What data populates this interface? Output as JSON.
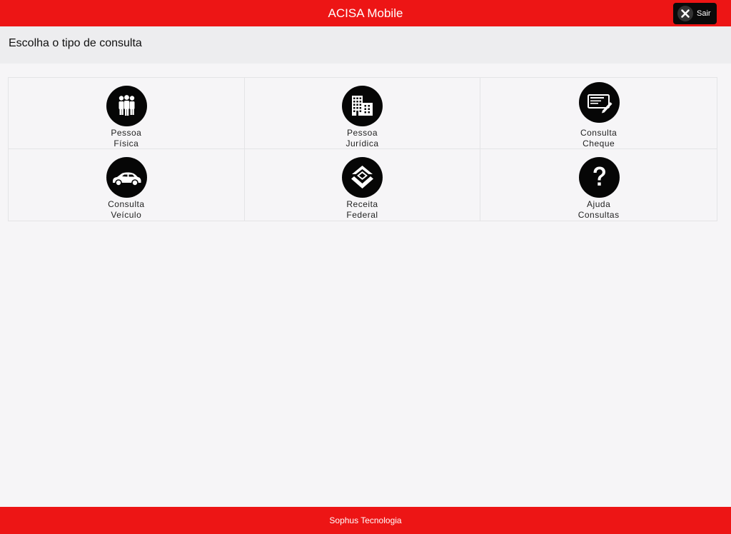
{
  "header": {
    "title": "ACISA Mobile",
    "exit_label": "Sair",
    "exit_icon": "close-icon",
    "bg_color": "#ed1515"
  },
  "subheader": {
    "title": "Escolha o tipo de consulta"
  },
  "tiles": [
    {
      "line1": "Pessoa",
      "line2": "Física",
      "icon": "people-icon"
    },
    {
      "line1": "Pessoa",
      "line2": "Jurídica",
      "icon": "buildings-icon"
    },
    {
      "line1": "Consulta",
      "line2": "Cheque",
      "icon": "check-icon"
    },
    {
      "line1": "Consulta",
      "line2": "Veículo",
      "icon": "car-icon"
    },
    {
      "line1": "Receita",
      "line2": "Federal",
      "icon": "receita-federal-icon"
    },
    {
      "line1": "Ajuda",
      "line2": "Consultas",
      "icon": "question-icon"
    }
  ],
  "footer": {
    "text": "Sophus Tecnologia"
  }
}
